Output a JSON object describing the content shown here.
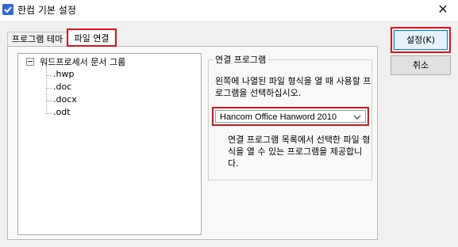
{
  "window": {
    "title": "한컴 기본 설정",
    "close_glyph": "✕"
  },
  "tabs": [
    {
      "label": "프로그램 테마",
      "active": false
    },
    {
      "label": "파일 연결",
      "active": true
    }
  ],
  "tree": {
    "root": "워드프로세서 문서 그룹",
    "items": [
      ".hwp",
      ".doc",
      ".docx",
      ".odt"
    ]
  },
  "association": {
    "group_title": "연결 프로그램",
    "description1": "왼쪽에 나열된 파일 형식을 열 때 사용할 프로그램을 선택하십시오.",
    "selected_program": "Hancom Office Hanword 2010",
    "description2": "연결 프로그램 목록에서 선택한 파일 형식을 열 수 있는 프로그램을 제공합니다."
  },
  "buttons": {
    "ok": "설정(K)",
    "cancel": "취소"
  },
  "colors": {
    "highlight": "#e0141e",
    "app_icon": "#2f6bd8"
  }
}
